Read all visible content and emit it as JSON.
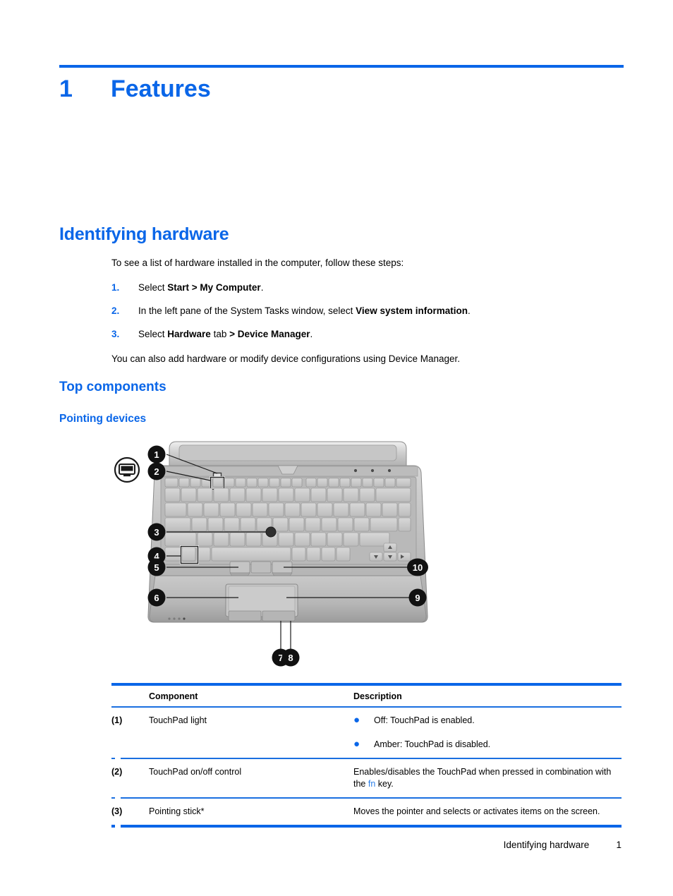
{
  "chapter": {
    "number": "1",
    "title": "Features"
  },
  "headings": {
    "h1": "Identifying hardware",
    "h2": "Top components",
    "h3": "Pointing devices"
  },
  "body": {
    "intro": "To see a list of hardware installed in the computer, follow these steps:",
    "steps": [
      {
        "num": "1.",
        "prefix": "Select ",
        "bold1": "Start > My Computer",
        "suffix": "."
      },
      {
        "num": "2.",
        "prefix": "In the left pane of the System Tasks window, select ",
        "bold1": "View system information",
        "suffix": "."
      },
      {
        "num": "3.",
        "prefix": "Select ",
        "bold1": "Hardware",
        "mid": " tab ",
        "bold2": "> Device Manager",
        "suffix": "."
      }
    ],
    "outro": "You can also add hardware or modify device configurations using Device Manager."
  },
  "figure": {
    "alt_name": "laptop-top-view-diagram",
    "icon_label": "display-icon",
    "callouts": [
      "1",
      "2",
      "3",
      "4",
      "5",
      "6",
      "7",
      "8",
      "9",
      "10"
    ]
  },
  "table": {
    "headers": [
      "Component",
      "Description"
    ],
    "rows": [
      {
        "num": "(1)",
        "component": "TouchPad light",
        "bullets": [
          "Off: TouchPad is enabled.",
          "Amber: TouchPad is disabled."
        ]
      },
      {
        "num": "(2)",
        "component": "TouchPad on/off control",
        "desc_pre": "Enables/disables the TouchPad when pressed in combination with the ",
        "desc_blue": "fn",
        "desc_post": " key."
      },
      {
        "num": "(3)",
        "component": "Pointing stick*",
        "desc": "Moves the pointer and selects or activates items on the screen."
      }
    ]
  },
  "footer": {
    "label": "Identifying hardware",
    "page": "1"
  },
  "colors": {
    "accent_blue": "#0a66e8",
    "rule_blue": "#1a6fe0",
    "inline_blue": "#2b7fe8",
    "text": "#000000"
  }
}
